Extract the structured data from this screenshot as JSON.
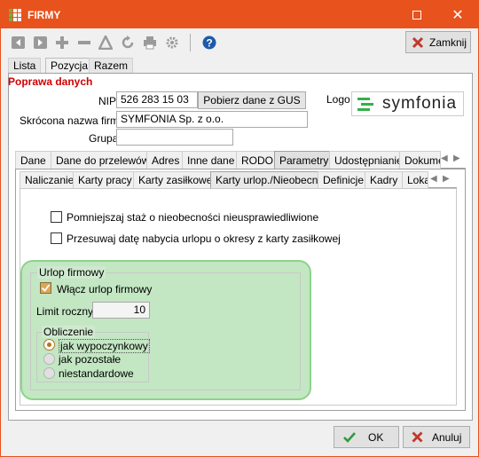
{
  "window": {
    "title": "FIRMY"
  },
  "toolbar": {
    "close_label": "Zamknij"
  },
  "top_tabs": [
    {
      "label": "Lista"
    },
    {
      "label": "Pozycja"
    },
    {
      "label": "Razem"
    }
  ],
  "panel": {
    "title": "Poprawa danych",
    "nip": {
      "label": "NIP",
      "value": "526 283 15 03"
    },
    "gus_button": "Pobierz dane z GUS",
    "short_name": {
      "label": "Skrócona nazwa firmy",
      "value": "SYMFONIA Sp. z o.o."
    },
    "group": {
      "label": "Grupa",
      "value": ""
    },
    "logo": {
      "label": "Logo",
      "brand": "symfonia"
    }
  },
  "tabs": [
    {
      "label": "Dane"
    },
    {
      "label": "Dane do przelewów"
    },
    {
      "label": "Adres"
    },
    {
      "label": "Inne dane"
    },
    {
      "label": "RODO"
    },
    {
      "label": "Parametry"
    },
    {
      "label": "Udostępnianie"
    },
    {
      "label": "Dokume"
    }
  ],
  "subtabs": [
    {
      "label": "Naliczanie"
    },
    {
      "label": "Karty pracy"
    },
    {
      "label": "Karty zasiłkowe"
    },
    {
      "label": "Karty urlop./Nieobecn."
    },
    {
      "label": "Definicje"
    },
    {
      "label": "Kadry"
    },
    {
      "label": "Loka"
    }
  ],
  "options": {
    "opt1": {
      "label": "Pomniejszaj staż o nieobecności nieusprawiedliwione",
      "checked": false
    },
    "opt2": {
      "label": "Przesuwaj datę nabycia urlopu o okresy z karty zasiłkowej",
      "checked": false
    }
  },
  "company_leave": {
    "group_title": "Urlop firmowy",
    "enable": {
      "label": "Włącz urlop firmowy",
      "checked": true
    },
    "limit": {
      "label": "Limit roczny",
      "value": "10"
    },
    "calc": {
      "title": "Obliczenie",
      "options": [
        {
          "label": "jak wypoczynkowy",
          "selected": true
        },
        {
          "label": "jak pozostałe",
          "selected": false
        },
        {
          "label": "niestandardowe",
          "selected": false
        }
      ]
    }
  },
  "footer": {
    "ok": "OK",
    "cancel": "Anuluj"
  },
  "colors": {
    "titlebar": "#e8521d",
    "highlight": "#8cd48c",
    "title_red": "#d00000",
    "accent_check": "#b5741e"
  }
}
